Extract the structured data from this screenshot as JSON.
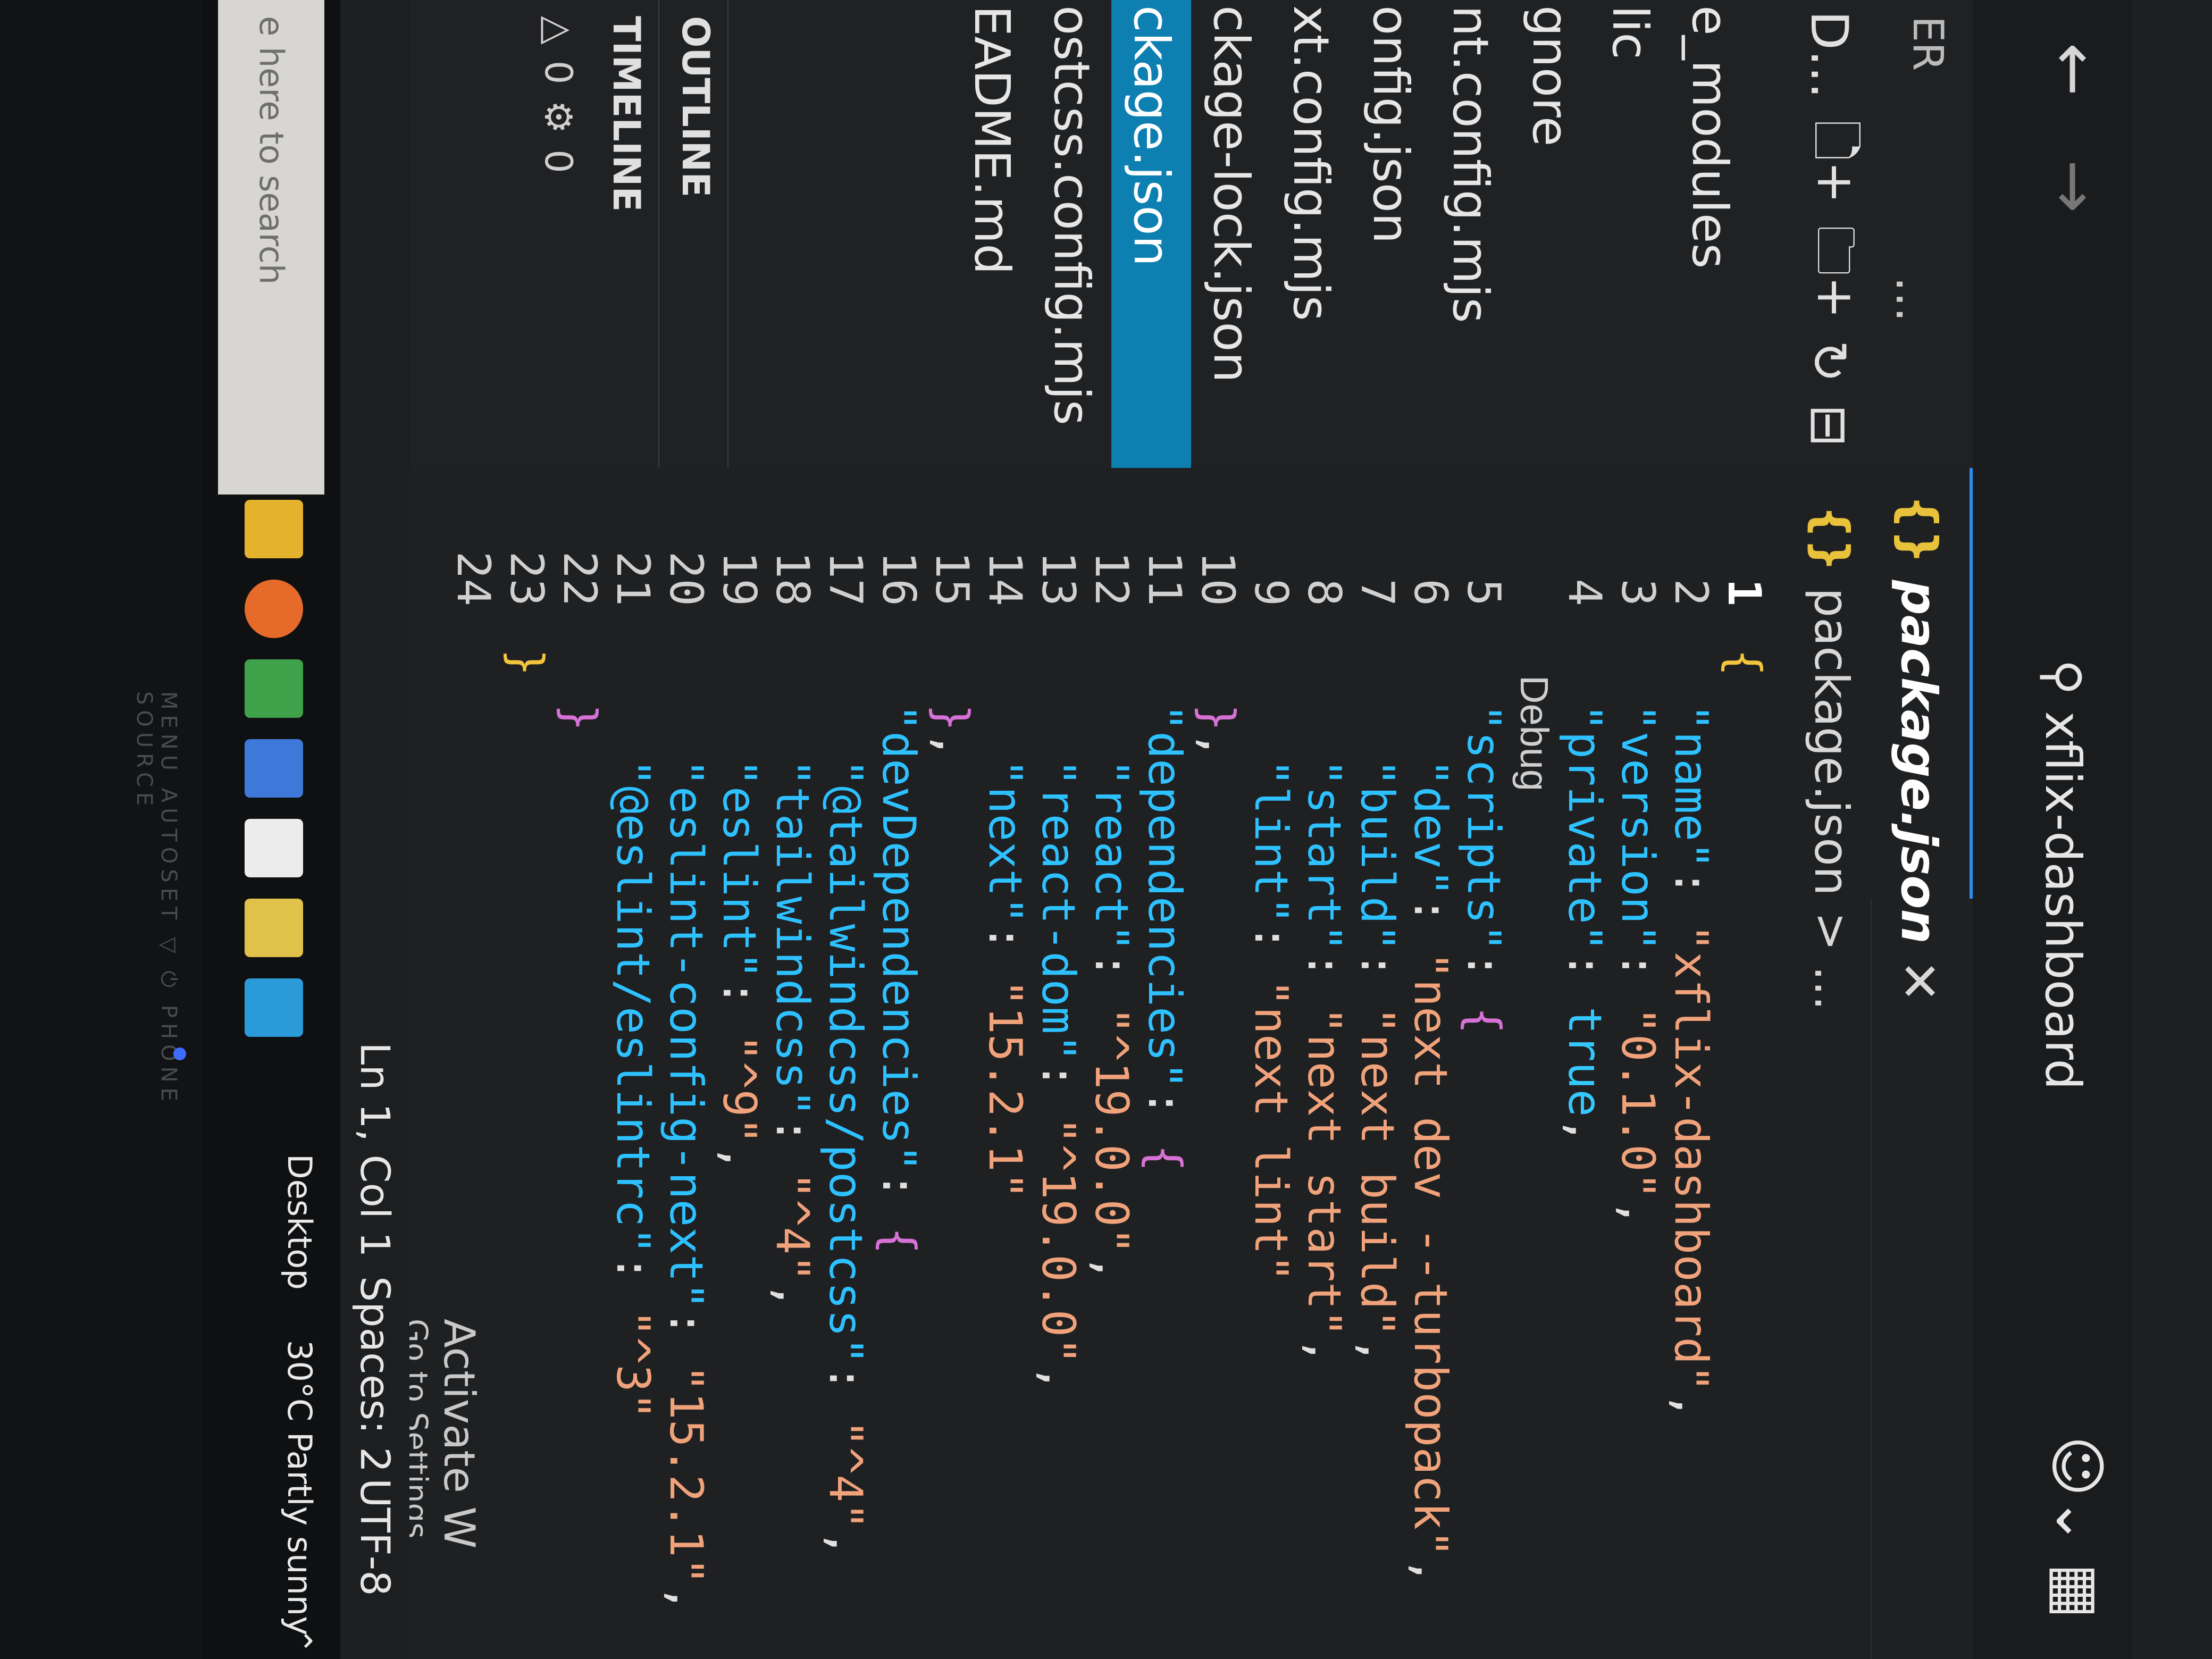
{
  "titlebar": {
    "search_text": "xflix-dashboard",
    "back_icon": "arrow-left-icon",
    "forward_icon": "arrow-right-icon",
    "search_icon": "search-icon",
    "copilot_icon": "copilot-icon",
    "layout_icon": "layout-icon"
  },
  "sidebar": {
    "header": "ER",
    "more": "...",
    "folder_prefix": "D...",
    "toolbar_icons": [
      "new-file-icon",
      "new-folder-icon",
      "refresh-icon",
      "collapse-icon"
    ],
    "files": [
      {
        "name": "e_modules",
        "active": false
      },
      {
        "name": "lic",
        "active": false
      },
      {
        "name": "gnore",
        "active": false
      },
      {
        "name": "nt.config.mjs",
        "active": false
      },
      {
        "name": "onfig.json",
        "active": false
      },
      {
        "name": "xt.config.mjs",
        "active": false
      },
      {
        "name": "ckage-lock.json",
        "active": false
      },
      {
        "name": "ckage.json",
        "active": true
      },
      {
        "name": "ostcss.config.mjs",
        "active": false
      },
      {
        "name": "EADME.md",
        "active": false
      }
    ],
    "outline_label": "OUTLINE",
    "timeline_label": "TIMELINE",
    "problems": {
      "errors": "0",
      "warnings": "0",
      "info": "0"
    }
  },
  "editor": {
    "tab_label": "package.json",
    "tab_icon": "{}",
    "breadcrumb_file": "package.json",
    "breadcrumb_rest": "> ...",
    "codelens": "Debug",
    "lines": [
      {
        "n": "1",
        "segs": [
          {
            "t": "{",
            "c": "br1"
          }
        ]
      },
      {
        "n": "2",
        "segs": [
          {
            "t": "  ",
            "c": "tx"
          },
          {
            "t": "\"name\"",
            "c": "k"
          },
          {
            "t": ": ",
            "c": "tx"
          },
          {
            "t": "\"xflix-dashboard\"",
            "c": "s"
          },
          {
            "t": ",",
            "c": "tx"
          }
        ]
      },
      {
        "n": "3",
        "segs": [
          {
            "t": "  ",
            "c": "tx"
          },
          {
            "t": "\"version\"",
            "c": "k"
          },
          {
            "t": ": ",
            "c": "tx"
          },
          {
            "t": "\"0.1.0\"",
            "c": "s"
          },
          {
            "t": ",",
            "c": "tx"
          }
        ]
      },
      {
        "n": "4",
        "segs": [
          {
            "t": "  ",
            "c": "tx"
          },
          {
            "t": "\"private\"",
            "c": "k"
          },
          {
            "t": ": ",
            "c": "tx"
          },
          {
            "t": "true",
            "c": "bool"
          },
          {
            "t": ",",
            "c": "tx"
          }
        ]
      },
      {
        "n": "5",
        "segs": [
          {
            "t": "  ",
            "c": "tx"
          },
          {
            "t": "\"scripts\"",
            "c": "k"
          },
          {
            "t": ": ",
            "c": "tx"
          },
          {
            "t": "{",
            "c": "br2"
          }
        ]
      },
      {
        "n": "6",
        "segs": [
          {
            "t": "    ",
            "c": "tx"
          },
          {
            "t": "\"dev\"",
            "c": "k"
          },
          {
            "t": ": ",
            "c": "tx"
          },
          {
            "t": "\"next dev --turbopack\"",
            "c": "s"
          },
          {
            "t": ",",
            "c": "tx"
          }
        ]
      },
      {
        "n": "7",
        "segs": [
          {
            "t": "    ",
            "c": "tx"
          },
          {
            "t": "\"build\"",
            "c": "k"
          },
          {
            "t": ": ",
            "c": "tx"
          },
          {
            "t": "\"next build\"",
            "c": "s"
          },
          {
            "t": ",",
            "c": "tx"
          }
        ]
      },
      {
        "n": "8",
        "segs": [
          {
            "t": "    ",
            "c": "tx"
          },
          {
            "t": "\"start\"",
            "c": "k"
          },
          {
            "t": ": ",
            "c": "tx"
          },
          {
            "t": "\"next start\"",
            "c": "s"
          },
          {
            "t": ",",
            "c": "tx"
          }
        ]
      },
      {
        "n": "9",
        "segs": [
          {
            "t": "    ",
            "c": "tx"
          },
          {
            "t": "\"lint\"",
            "c": "k"
          },
          {
            "t": ": ",
            "c": "tx"
          },
          {
            "t": "\"next lint\"",
            "c": "s"
          }
        ]
      },
      {
        "n": "10",
        "segs": [
          {
            "t": "  ",
            "c": "tx"
          },
          {
            "t": "}",
            "c": "br2"
          },
          {
            "t": ",",
            "c": "tx"
          }
        ]
      },
      {
        "n": "11",
        "segs": [
          {
            "t": "  ",
            "c": "tx"
          },
          {
            "t": "\"dependencies\"",
            "c": "k"
          },
          {
            "t": ": ",
            "c": "tx"
          },
          {
            "t": "{",
            "c": "br2"
          }
        ]
      },
      {
        "n": "12",
        "segs": [
          {
            "t": "    ",
            "c": "tx"
          },
          {
            "t": "\"react\"",
            "c": "k"
          },
          {
            "t": ": ",
            "c": "tx"
          },
          {
            "t": "\"^19.0.0\"",
            "c": "s"
          },
          {
            "t": ",",
            "c": "tx"
          }
        ]
      },
      {
        "n": "13",
        "segs": [
          {
            "t": "    ",
            "c": "tx"
          },
          {
            "t": "\"react-dom\"",
            "c": "k"
          },
          {
            "t": ": ",
            "c": "tx"
          },
          {
            "t": "\"^19.0.0\"",
            "c": "s"
          },
          {
            "t": ",",
            "c": "tx"
          }
        ]
      },
      {
        "n": "14",
        "segs": [
          {
            "t": "    ",
            "c": "tx"
          },
          {
            "t": "\"next\"",
            "c": "k"
          },
          {
            "t": ": ",
            "c": "tx"
          },
          {
            "t": "\"15.2.1\"",
            "c": "s"
          }
        ]
      },
      {
        "n": "15",
        "segs": [
          {
            "t": "  ",
            "c": "tx"
          },
          {
            "t": "}",
            "c": "br2"
          },
          {
            "t": ",",
            "c": "tx"
          }
        ]
      },
      {
        "n": "16",
        "segs": [
          {
            "t": "  ",
            "c": "tx"
          },
          {
            "t": "\"devDependencies\"",
            "c": "k"
          },
          {
            "t": ": ",
            "c": "tx"
          },
          {
            "t": "{",
            "c": "br2"
          }
        ]
      },
      {
        "n": "17",
        "segs": [
          {
            "t": "    ",
            "c": "tx"
          },
          {
            "t": "\"@tailwindcss/postcss\"",
            "c": "k"
          },
          {
            "t": ": ",
            "c": "tx"
          },
          {
            "t": "\"^4\"",
            "c": "s"
          },
          {
            "t": ",",
            "c": "tx"
          }
        ]
      },
      {
        "n": "18",
        "segs": [
          {
            "t": "    ",
            "c": "tx"
          },
          {
            "t": "\"tailwindcss\"",
            "c": "k"
          },
          {
            "t": ": ",
            "c": "tx"
          },
          {
            "t": "\"^4\"",
            "c": "s"
          },
          {
            "t": ",",
            "c": "tx"
          }
        ]
      },
      {
        "n": "19",
        "segs": [
          {
            "t": "    ",
            "c": "tx"
          },
          {
            "t": "\"eslint\"",
            "c": "k"
          },
          {
            "t": ": ",
            "c": "tx"
          },
          {
            "t": "\"^9\"",
            "c": "s"
          },
          {
            "t": ",",
            "c": "tx"
          }
        ]
      },
      {
        "n": "20",
        "segs": [
          {
            "t": "    ",
            "c": "tx"
          },
          {
            "t": "\"eslint-config-next\"",
            "c": "k"
          },
          {
            "t": ": ",
            "c": "tx"
          },
          {
            "t": "\"15.2.1\"",
            "c": "s"
          },
          {
            "t": ",",
            "c": "tx"
          }
        ]
      },
      {
        "n": "21",
        "segs": [
          {
            "t": "    ",
            "c": "tx"
          },
          {
            "t": "\"@eslint/eslintrc\"",
            "c": "k"
          },
          {
            "t": ": ",
            "c": "tx"
          },
          {
            "t": "\"^3\"",
            "c": "s"
          }
        ]
      },
      {
        "n": "22",
        "segs": [
          {
            "t": "  ",
            "c": "tx"
          },
          {
            "t": "}",
            "c": "br2"
          }
        ]
      },
      {
        "n": "23",
        "segs": [
          {
            "t": "}",
            "c": "br1"
          }
        ]
      },
      {
        "n": "24",
        "segs": []
      }
    ]
  },
  "statusbar": {
    "position": "Ln 1, Col 1",
    "spaces": "Spaces: 2",
    "encoding": "UTF-8",
    "activate_title": "Activate W",
    "activate_sub": "Go to Settings"
  },
  "taskbar": {
    "search_placeholder": "e here to search",
    "desktop_label": "Desktop",
    "weather": "30°C  Partly sunny"
  },
  "bezel": {
    "text": "MENU   AUTOSET   ▽   ⏻ PHONE SOURCE"
  },
  "colors": {
    "key": "#2ec1ff",
    "string": "#f0a27a",
    "bracket_outer": "#f2c53d",
    "bracket_inner": "#d672d6",
    "selection": "#0e7fb1"
  }
}
